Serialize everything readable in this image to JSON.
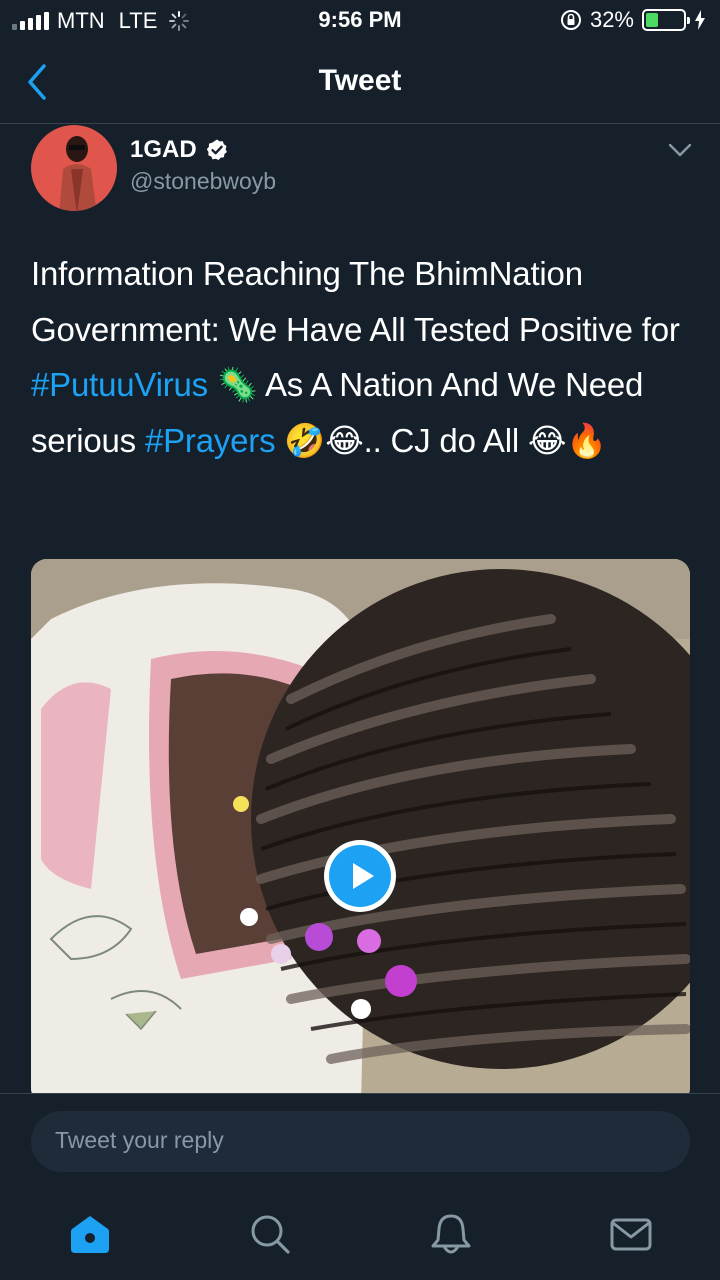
{
  "status_bar": {
    "carrier": "MTN",
    "network": "LTE",
    "time": "9:56 PM",
    "battery_percent": "32%",
    "battery_level": 0.32,
    "icons": [
      "signal-icon",
      "activity-spinner-icon",
      "orientation-lock-icon",
      "battery-icon",
      "charging-bolt-icon"
    ]
  },
  "nav": {
    "title": "Tweet",
    "back_icon": "chevron-left-icon"
  },
  "tweet": {
    "author_name": "1GAD",
    "author_handle": "@stonebwoyb",
    "verified": true,
    "text_parts": {
      "p1": "Information Reaching The BhimNation Government: We Have All Tested Positive for ",
      "tag1": "#PutuuVirus",
      "p2": " 🦠 As A Nation And We Need serious ",
      "tag2": "#Prayers",
      "p3": " 🤣😂.. CJ do All 😂🔥"
    },
    "media": {
      "type": "video",
      "play_icon": "play-button-icon"
    }
  },
  "reply": {
    "placeholder": "Tweet your reply"
  },
  "tabbar": {
    "items": [
      "home-icon",
      "search-icon",
      "notifications-icon",
      "messages-icon"
    ],
    "active": "home-icon"
  },
  "colors": {
    "background": "#15202b",
    "accent": "#1da1f2",
    "secondary_text": "#8899a6",
    "divider": "#38444d"
  }
}
